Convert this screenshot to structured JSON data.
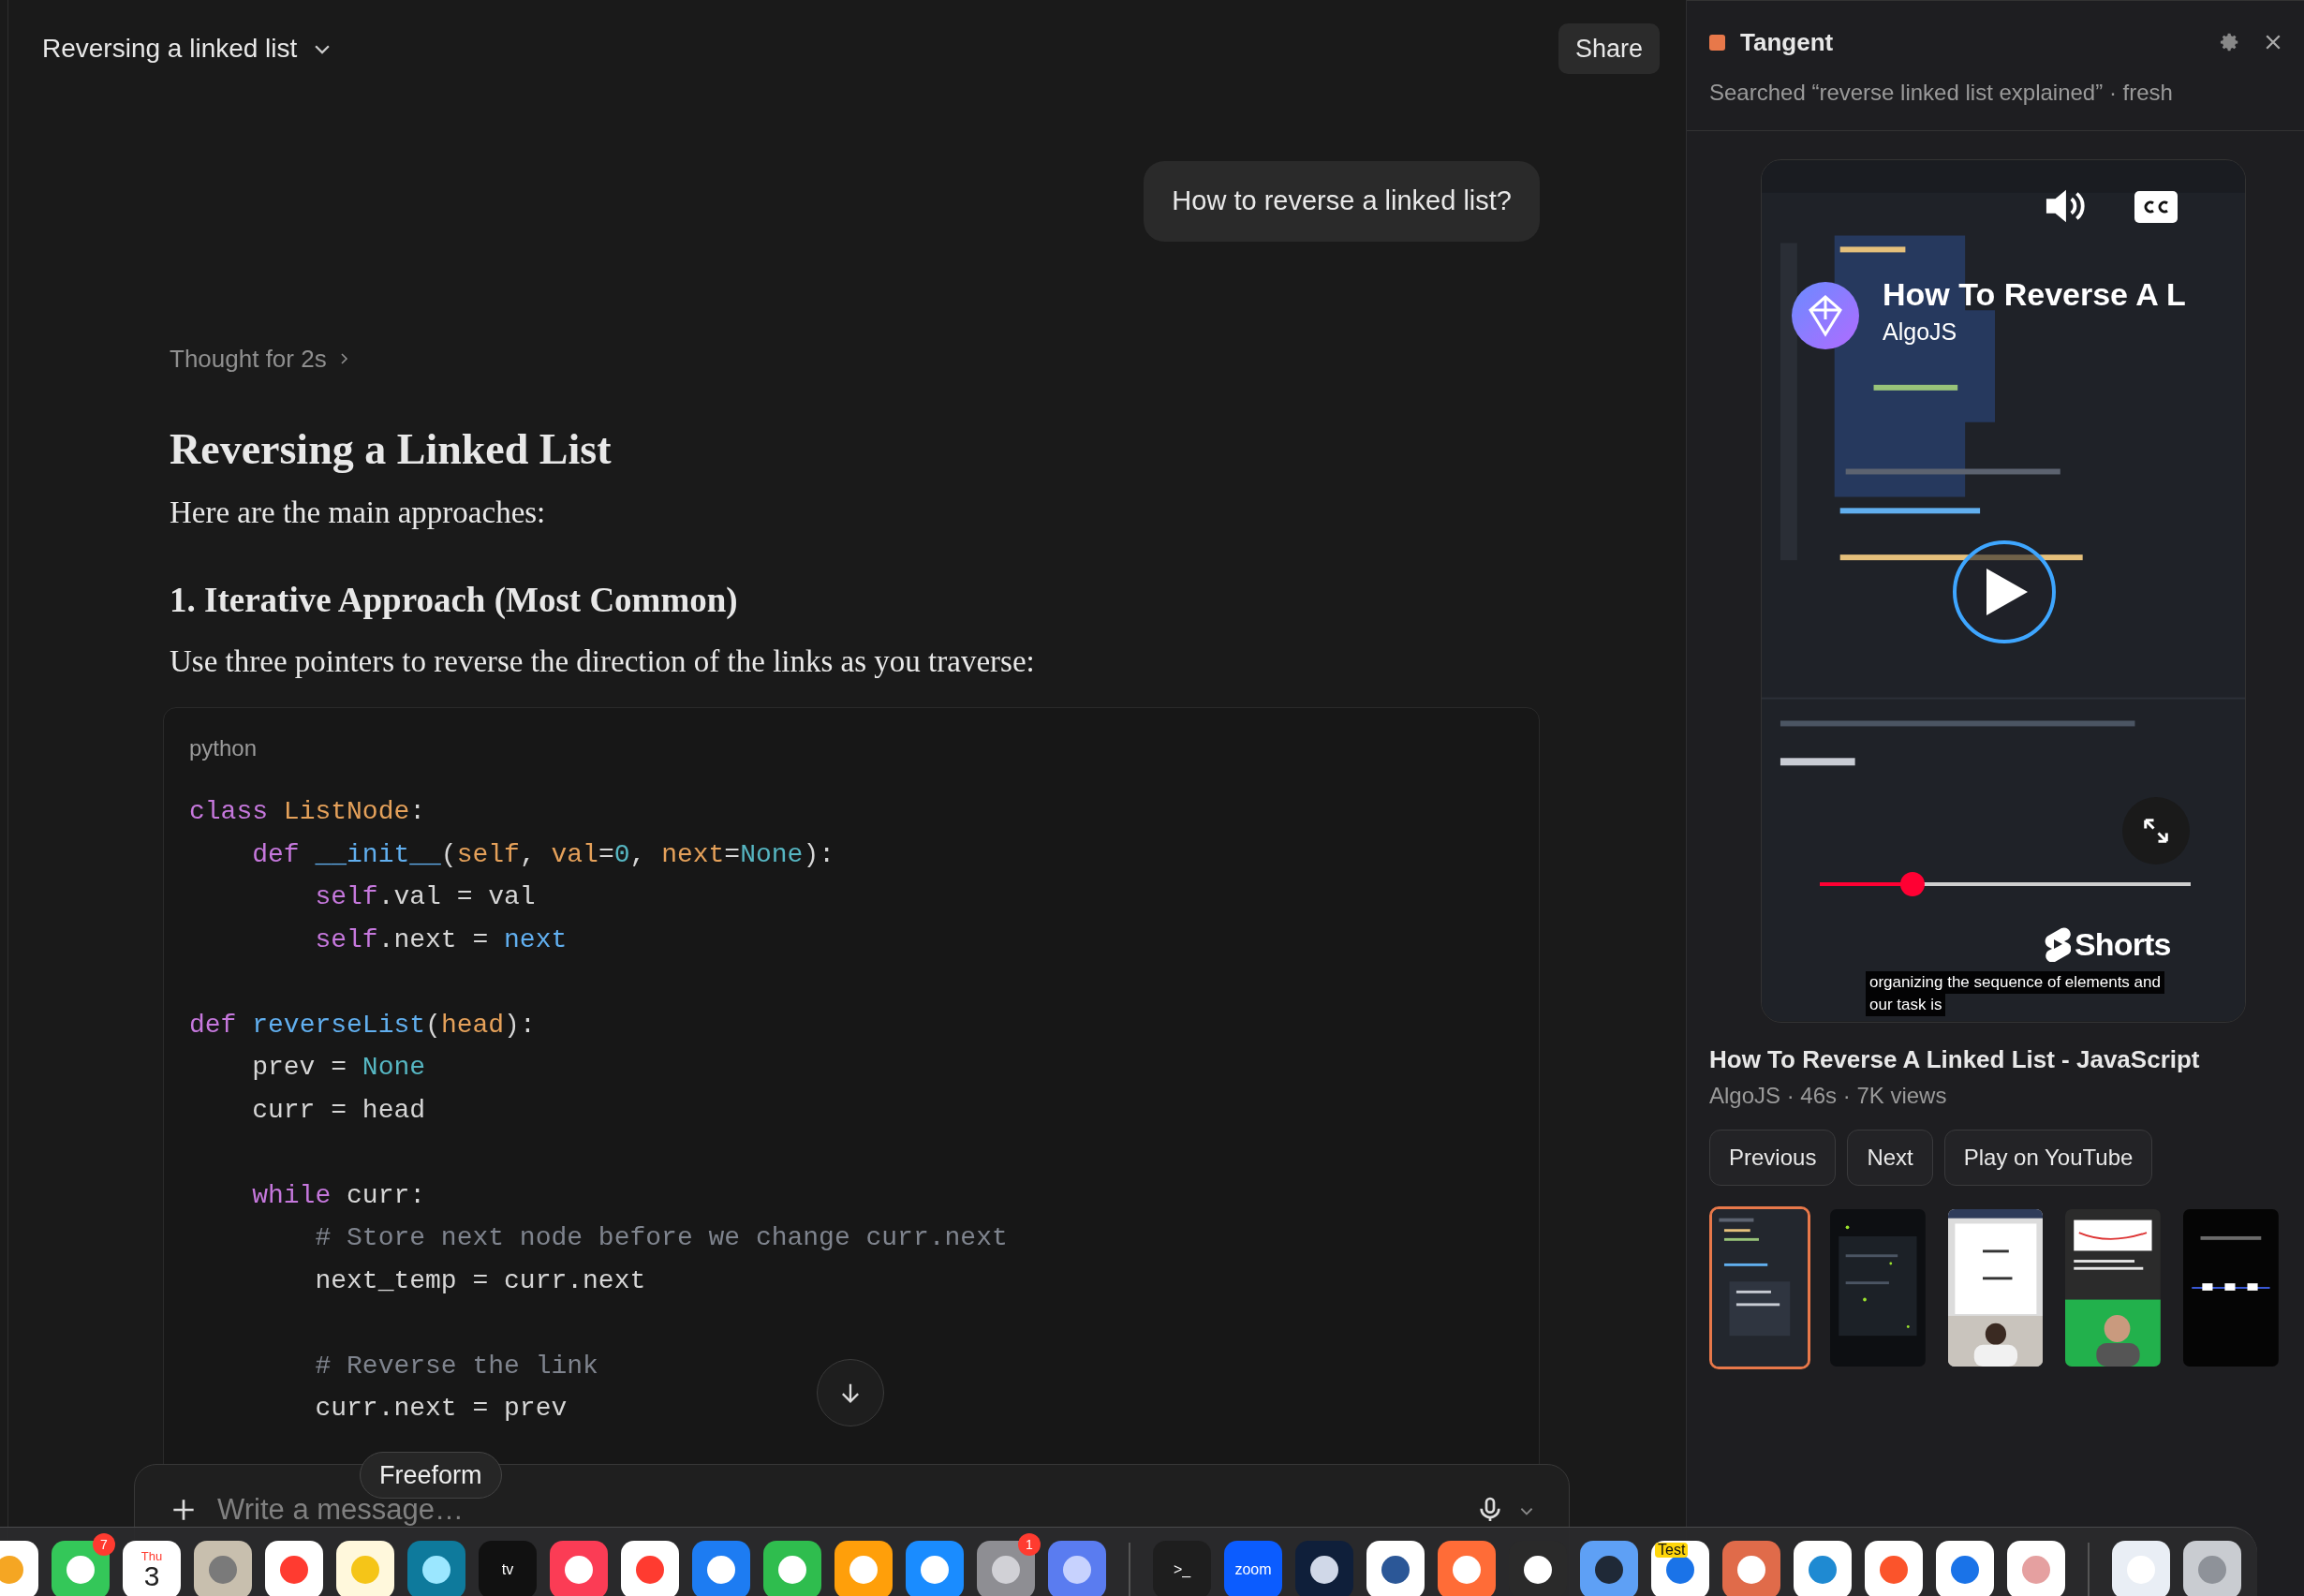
{
  "header": {
    "title": "Reversing a linked list",
    "share": "Share"
  },
  "conversation": {
    "user_message": "How to reverse a linked list?",
    "thought": "Thought for 2s",
    "heading": "Reversing a Linked List",
    "intro": "Here are the main approaches:",
    "subheading": "1. Iterative Approach (Most Common)",
    "paragraph": "Use three pointers to reverse the direction of the links as you traverse:"
  },
  "code_block": {
    "language": "python",
    "groups": [
      [
        [
          {
            "text": "class ",
            "kind": "kw"
          },
          {
            "text": "ListNode",
            "kind": "cls"
          },
          {
            "text": ":",
            "kind": "plain"
          }
        ],
        [
          {
            "text": "    def ",
            "kind": "kw"
          },
          {
            "text": "__init__",
            "kind": "fn"
          },
          {
            "text": "(",
            "kind": "plain"
          },
          {
            "text": "self",
            "kind": "param"
          },
          {
            "text": ", ",
            "kind": "plain"
          },
          {
            "text": "val",
            "kind": "param"
          },
          {
            "text": "=",
            "kind": "plain"
          },
          {
            "text": "0",
            "kind": "const"
          },
          {
            "text": ", ",
            "kind": "plain"
          },
          {
            "text": "next",
            "kind": "param"
          },
          {
            "text": "=",
            "kind": "plain"
          },
          {
            "text": "None",
            "kind": "const"
          },
          {
            "text": "):",
            "kind": "plain"
          }
        ],
        [
          {
            "text": "        self",
            "kind": "kw"
          },
          {
            "text": ".val = val",
            "kind": "plain"
          }
        ],
        [
          {
            "text": "        self",
            "kind": "kw"
          },
          {
            "text": ".next = ",
            "kind": "plain"
          },
          {
            "text": "next",
            "kind": "fn"
          }
        ]
      ],
      [
        [
          {
            "text": "def ",
            "kind": "kw"
          },
          {
            "text": "reverseList",
            "kind": "fn"
          },
          {
            "text": "(",
            "kind": "plain"
          },
          {
            "text": "head",
            "kind": "param"
          },
          {
            "text": "):",
            "kind": "plain"
          }
        ],
        [
          {
            "text": "    prev = ",
            "kind": "plain"
          },
          {
            "text": "None",
            "kind": "const"
          }
        ],
        [
          {
            "text": "    curr = head",
            "kind": "plain"
          }
        ]
      ],
      [
        [
          {
            "text": "    while ",
            "kind": "kw"
          },
          {
            "text": "curr:",
            "kind": "plain"
          }
        ],
        [
          {
            "text": "        # Store next node before we change curr.next",
            "kind": "comment"
          }
        ],
        [
          {
            "text": "        next_temp = curr.next",
            "kind": "plain"
          }
        ]
      ],
      [
        [
          {
            "text": "        # Reverse the link",
            "kind": "comment"
          }
        ],
        [
          {
            "text": "        curr.next = prev",
            "kind": "plain"
          }
        ]
      ]
    ]
  },
  "composer": {
    "placeholder": "Write a message…"
  },
  "tooltip": "Freeform",
  "tangent": {
    "title": "Tangent",
    "status": "Searched “reverse linked list explained” · fresh",
    "player": {
      "overlay_title": "How To Reverse A L",
      "channel": "AlgoJS",
      "logo": "Shorts",
      "captions": [
        "organizing the sequence of elements and",
        "our task is"
      ],
      "level": 0.25
    },
    "video_title": "How To Reverse A Linked List - JavaScript",
    "meta": "AlgoJS · 46s · 7K views",
    "buttons": [
      "Previous",
      "Next",
      "Play on YouTube"
    ],
    "thumbnails": [
      {
        "kind": "code",
        "selected": true
      },
      {
        "kind": "stars",
        "selected": false
      },
      {
        "kind": "whiteboard",
        "selected": false
      },
      {
        "kind": "greenscreen",
        "selected": false
      },
      {
        "kind": "dark",
        "selected": false
      }
    ]
  },
  "dock": [
    {
      "kind": "photos"
    },
    {
      "kind": "video-call",
      "badge": "7"
    },
    {
      "kind": "calendar",
      "day": "Thu",
      "date": "3"
    },
    {
      "kind": "contacts"
    },
    {
      "kind": "reminders"
    },
    {
      "kind": "notes"
    },
    {
      "kind": "freeform"
    },
    {
      "kind": "tv",
      "label": "tv"
    },
    {
      "kind": "music"
    },
    {
      "kind": "news"
    },
    {
      "kind": "keynote"
    },
    {
      "kind": "numbers"
    },
    {
      "kind": "pages"
    },
    {
      "kind": "app-store"
    },
    {
      "kind": "settings",
      "badge": "1"
    },
    {
      "kind": "phone"
    },
    {
      "kind": "separator"
    },
    {
      "kind": "terminal",
      "label": ">_"
    },
    {
      "kind": "zoom",
      "label": "zoom"
    },
    {
      "kind": "compass"
    },
    {
      "kind": "word"
    },
    {
      "kind": "rocket"
    },
    {
      "kind": "piano"
    },
    {
      "kind": "magnifier"
    },
    {
      "kind": "browser",
      "label": "Test"
    },
    {
      "kind": "burst"
    },
    {
      "kind": "code"
    },
    {
      "kind": "lion"
    },
    {
      "kind": "browser"
    },
    {
      "kind": "paper"
    },
    {
      "kind": "separator"
    },
    {
      "kind": "document"
    },
    {
      "kind": "trash"
    }
  ]
}
